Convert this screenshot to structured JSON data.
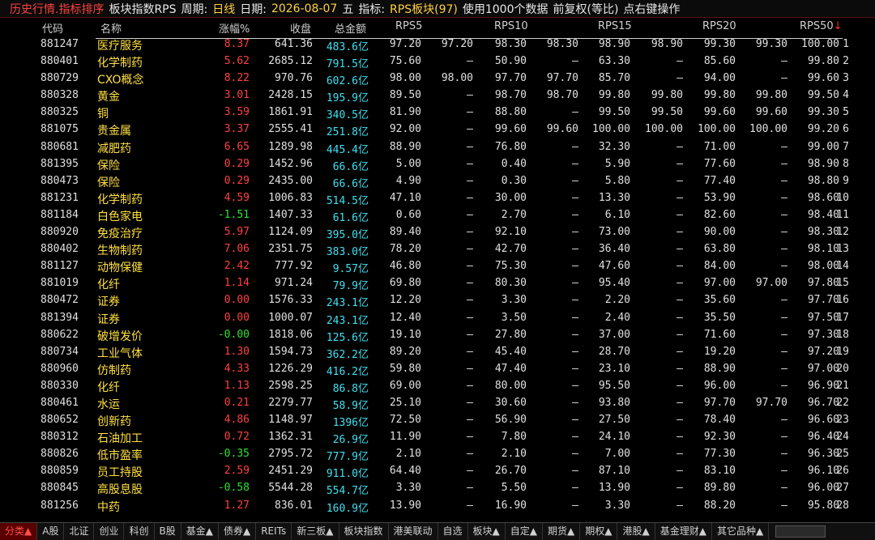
{
  "title": {
    "part1": "历史行情.指标排序",
    "part2": "板块指数RPS",
    "part3": "周期:",
    "part4": "日线",
    "part5": "日期:",
    "part6": "2026-08-07",
    "part7": "五",
    "part8": "指标:",
    "part9": "RPS板块(97)",
    "part10": "使用1000个数据",
    "part11": "前复权(等比)",
    "part12": "点右键操作"
  },
  "columns": {
    "code": "代码",
    "name": "名称",
    "change": "涨幅%",
    "price": "收盘",
    "amount": "总金额",
    "rps5": "RPS5",
    "rps10": "RPS10",
    "rps15": "RPS15",
    "rps20": "RPS20",
    "rps50": "RPS50",
    "sort_arrow": "↓"
  },
  "rows": [
    {
      "i": "1",
      "code": "881247",
      "name": "医疗服务",
      "chg": "8.37",
      "dir": "up",
      "price": "641.36",
      "amt": "483.6亿",
      "c1": "97.20",
      "c2": "97.20",
      "c3": "98.30",
      "c4": "98.30",
      "c5": "98.90",
      "c6": "98.90",
      "c7": "99.30",
      "c8": "99.30",
      "c9": "100.00"
    },
    {
      "i": "2",
      "code": "880401",
      "name": "化学制药",
      "chg": "5.62",
      "dir": "up",
      "price": "2685.12",
      "amt": "791.5亿",
      "c1": "75.60",
      "c2": "–",
      "c3": "50.90",
      "c4": "–",
      "c5": "63.30",
      "c6": "–",
      "c7": "85.60",
      "c8": "–",
      "c9": "99.80"
    },
    {
      "i": "3",
      "code": "880729",
      "name": "CXO概念",
      "chg": "8.22",
      "dir": "up",
      "price": "970.76",
      "amt": "602.6亿",
      "c1": "98.00",
      "c2": "98.00",
      "c3": "97.70",
      "c4": "97.70",
      "c5": "85.70",
      "c6": "–",
      "c7": "94.00",
      "c8": "–",
      "c9": "99.60"
    },
    {
      "i": "4",
      "code": "880328",
      "name": "黄金",
      "chg": "3.01",
      "dir": "up",
      "price": "2428.15",
      "amt": "195.9亿",
      "c1": "89.50",
      "c2": "–",
      "c3": "98.70",
      "c4": "98.70",
      "c5": "99.80",
      "c6": "99.80",
      "c7": "99.80",
      "c8": "99.80",
      "c9": "99.50"
    },
    {
      "i": "5",
      "code": "880325",
      "name": "铜",
      "chg": "3.59",
      "dir": "up",
      "price": "1861.91",
      "amt": "340.5亿",
      "c1": "81.90",
      "c2": "–",
      "c3": "88.80",
      "c4": "–",
      "c5": "99.50",
      "c6": "99.50",
      "c7": "99.60",
      "c8": "99.60",
      "c9": "99.30"
    },
    {
      "i": "6",
      "code": "881075",
      "name": "贵金属",
      "chg": "3.37",
      "dir": "up",
      "price": "2555.41",
      "amt": "251.8亿",
      "c1": "92.00",
      "c2": "–",
      "c3": "99.60",
      "c4": "99.60",
      "c5": "100.00",
      "c6": "100.00",
      "c7": "100.00",
      "c8": "100.00",
      "c9": "99.20"
    },
    {
      "i": "7",
      "code": "880681",
      "name": "减肥药",
      "chg": "6.65",
      "dir": "up",
      "price": "1289.98",
      "amt": "445.4亿",
      "c1": "88.90",
      "c2": "–",
      "c3": "76.80",
      "c4": "–",
      "c5": "32.30",
      "c6": "–",
      "c7": "71.00",
      "c8": "–",
      "c9": "99.00"
    },
    {
      "i": "8",
      "code": "881395",
      "name": "保险",
      "chg": "0.29",
      "dir": "up",
      "price": "1452.96",
      "amt": "66.6亿",
      "c1": "5.00",
      "c2": "–",
      "c3": "0.40",
      "c4": "–",
      "c5": "5.90",
      "c6": "–",
      "c7": "77.60",
      "c8": "–",
      "c9": "98.90"
    },
    {
      "i": "9",
      "code": "880473",
      "name": "保险",
      "chg": "0.29",
      "dir": "up",
      "price": "2435.00",
      "amt": "66.6亿",
      "c1": "4.90",
      "c2": "–",
      "c3": "0.30",
      "c4": "–",
      "c5": "5.80",
      "c6": "–",
      "c7": "77.40",
      "c8": "–",
      "c9": "98.80"
    },
    {
      "i": "10",
      "code": "881231",
      "name": "化学制药",
      "chg": "4.59",
      "dir": "up",
      "price": "1006.83",
      "amt": "514.5亿",
      "c1": "47.10",
      "c2": "–",
      "c3": "30.00",
      "c4": "–",
      "c5": "13.30",
      "c6": "–",
      "c7": "53.90",
      "c8": "–",
      "c9": "98.60"
    },
    {
      "i": "11",
      "code": "881184",
      "name": "白色家电",
      "chg": "-1.51",
      "dir": "down",
      "price": "1407.33",
      "amt": "61.6亿",
      "c1": "0.60",
      "c2": "–",
      "c3": "2.70",
      "c4": "–",
      "c5": "6.10",
      "c6": "–",
      "c7": "82.60",
      "c8": "–",
      "c9": "98.40"
    },
    {
      "i": "12",
      "code": "880920",
      "name": "免疫治疗",
      "chg": "5.97",
      "dir": "up",
      "price": "1124.09",
      "amt": "395.0亿",
      "c1": "89.40",
      "c2": "–",
      "c3": "92.10",
      "c4": "–",
      "c5": "73.00",
      "c6": "–",
      "c7": "90.00",
      "c8": "–",
      "c9": "98.30"
    },
    {
      "i": "13",
      "code": "880402",
      "name": "生物制药",
      "chg": "7.06",
      "dir": "up",
      "price": "2351.75",
      "amt": "383.0亿",
      "c1": "78.20",
      "c2": "–",
      "c3": "42.70",
      "c4": "–",
      "c5": "36.40",
      "c6": "–",
      "c7": "63.80",
      "c8": "–",
      "c9": "98.10"
    },
    {
      "i": "14",
      "code": "881127",
      "name": "动物保健",
      "chg": "2.42",
      "dir": "up",
      "price": "777.92",
      "amt": "9.57亿",
      "c1": "46.80",
      "c2": "–",
      "c3": "75.30",
      "c4": "–",
      "c5": "47.60",
      "c6": "–",
      "c7": "84.00",
      "c8": "–",
      "c9": "98.00"
    },
    {
      "i": "15",
      "code": "881019",
      "name": "化纤",
      "chg": "1.14",
      "dir": "up",
      "price": "971.24",
      "amt": "79.9亿",
      "c1": "69.80",
      "c2": "–",
      "c3": "80.30",
      "c4": "–",
      "c5": "95.40",
      "c6": "–",
      "c7": "97.00",
      "c8": "97.00",
      "c9": "97.80"
    },
    {
      "i": "16",
      "code": "880472",
      "name": "证券",
      "chg": "0.00",
      "dir": "flat",
      "price": "1576.33",
      "amt": "243.1亿",
      "c1": "12.20",
      "c2": "–",
      "c3": "3.30",
      "c4": "–",
      "c5": "2.20",
      "c6": "–",
      "c7": "35.60",
      "c8": "–",
      "c9": "97.70"
    },
    {
      "i": "17",
      "code": "881394",
      "name": "证券",
      "chg": "0.00",
      "dir": "flat",
      "price": "1000.07",
      "amt": "243.1亿",
      "c1": "12.40",
      "c2": "–",
      "c3": "3.50",
      "c4": "–",
      "c5": "2.40",
      "c6": "–",
      "c7": "35.50",
      "c8": "–",
      "c9": "97.50"
    },
    {
      "i": "18",
      "code": "880622",
      "name": "破增发价",
      "chg": "-0.00",
      "dir": "down",
      "price": "1818.06",
      "amt": "125.6亿",
      "c1": "19.10",
      "c2": "–",
      "c3": "27.80",
      "c4": "–",
      "c5": "37.00",
      "c6": "–",
      "c7": "71.60",
      "c8": "–",
      "c9": "97.30"
    },
    {
      "i": "19",
      "code": "880734",
      "name": "工业气体",
      "chg": "1.30",
      "dir": "up",
      "price": "1594.73",
      "amt": "362.2亿",
      "c1": "89.20",
      "c2": "–",
      "c3": "45.40",
      "c4": "–",
      "c5": "28.70",
      "c6": "–",
      "c7": "19.20",
      "c8": "–",
      "c9": "97.20"
    },
    {
      "i": "20",
      "code": "880960",
      "name": "仿制药",
      "chg": "4.33",
      "dir": "up",
      "price": "1226.29",
      "amt": "416.2亿",
      "c1": "59.80",
      "c2": "–",
      "c3": "47.40",
      "c4": "–",
      "c5": "23.10",
      "c6": "–",
      "c7": "88.90",
      "c8": "–",
      "c9": "97.00"
    },
    {
      "i": "21",
      "code": "880330",
      "name": "化纤",
      "chg": "1.13",
      "dir": "up",
      "price": "2598.25",
      "amt": "86.8亿",
      "c1": "69.00",
      "c2": "–",
      "c3": "80.00",
      "c4": "–",
      "c5": "95.50",
      "c6": "–",
      "c7": "96.00",
      "c8": "–",
      "c9": "96.90"
    },
    {
      "i": "22",
      "code": "880461",
      "name": "水运",
      "chg": "0.21",
      "dir": "up",
      "price": "2279.77",
      "amt": "58.9亿",
      "c1": "25.10",
      "c2": "–",
      "c3": "30.60",
      "c4": "–",
      "c5": "93.80",
      "c6": "–",
      "c7": "97.70",
      "c8": "97.70",
      "c9": "96.70"
    },
    {
      "i": "23",
      "code": "880652",
      "name": "创新药",
      "chg": "4.86",
      "dir": "up",
      "price": "1148.97",
      "amt": "1396亿",
      "c1": "72.50",
      "c2": "–",
      "c3": "56.90",
      "c4": "–",
      "c5": "27.50",
      "c6": "–",
      "c7": "78.40",
      "c8": "–",
      "c9": "96.60"
    },
    {
      "i": "24",
      "code": "880312",
      "name": "石油加工",
      "chg": "0.72",
      "dir": "up",
      "price": "1362.31",
      "amt": "26.9亿",
      "c1": "11.90",
      "c2": "–",
      "c3": "7.80",
      "c4": "–",
      "c5": "24.10",
      "c6": "–",
      "c7": "92.30",
      "c8": "–",
      "c9": "96.40"
    },
    {
      "i": "25",
      "code": "880826",
      "name": "低市盈率",
      "chg": "-0.35",
      "dir": "down",
      "price": "2795.72",
      "amt": "777.9亿",
      "c1": "2.10",
      "c2": "–",
      "c3": "2.10",
      "c4": "–",
      "c5": "7.00",
      "c6": "–",
      "c7": "77.30",
      "c8": "–",
      "c9": "96.30"
    },
    {
      "i": "26",
      "code": "880859",
      "name": "员工持股",
      "chg": "2.59",
      "dir": "up",
      "price": "2451.29",
      "amt": "911.0亿",
      "c1": "64.40",
      "c2": "–",
      "c3": "26.70",
      "c4": "–",
      "c5": "87.10",
      "c6": "–",
      "c7": "83.10",
      "c8": "–",
      "c9": "96.10"
    },
    {
      "i": "27",
      "code": "880845",
      "name": "高股息股",
      "chg": "-0.58",
      "dir": "down",
      "price": "5544.28",
      "amt": "554.7亿",
      "c1": "3.30",
      "c2": "–",
      "c3": "5.50",
      "c4": "–",
      "c5": "13.90",
      "c6": "–",
      "c7": "89.80",
      "c8": "–",
      "c9": "96.00"
    },
    {
      "i": "28",
      "code": "881256",
      "name": "中药",
      "chg": "1.27",
      "dir": "up",
      "price": "836.01",
      "amt": "160.9亿",
      "c1": "13.90",
      "c2": "–",
      "c3": "16.90",
      "c4": "–",
      "c5": "3.30",
      "c6": "–",
      "c7": "88.20",
      "c8": "–",
      "c9": "95.80"
    }
  ],
  "tabs": [
    "分类▲",
    "A股",
    "北证",
    "创业",
    "科创",
    "B股",
    "基金▲",
    "债券▲",
    "REITs",
    "新三板▲",
    "板块指数",
    "港美联动",
    "自选",
    "板块▲",
    "自定▲",
    "期货▲",
    "期权▲",
    "港股▲",
    "基金理财▲",
    "其它品种▲"
  ],
  "colors": {
    "up": "#ff4040",
    "down": "#30e030",
    "amount": "#40e0f0",
    "name": "#ffe040",
    "background": "#000000"
  }
}
